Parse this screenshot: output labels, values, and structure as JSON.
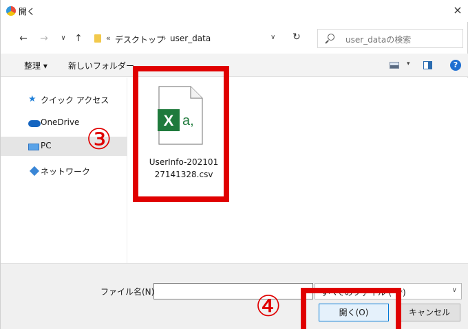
{
  "window": {
    "title": "開く",
    "close": "×"
  },
  "nav": {
    "back": "←",
    "forward": "→",
    "recent": "∨",
    "up": "↑",
    "breadcrumb_sep1": "«",
    "breadcrumb": [
      "デスクトップ",
      "user_data"
    ],
    "breadcrumb_sep2": "›",
    "address_dropdown": "∨",
    "refresh": "↻",
    "search_placeholder": "user_dataの検索"
  },
  "toolbar": {
    "organize": "整理 ▾",
    "new_folder": "新しいフォルダー",
    "view_dropdown": "▾",
    "help": "?"
  },
  "sidebar": {
    "items": [
      {
        "label": "クイック アクセス",
        "icon": "star-icon"
      },
      {
        "label": "OneDrive",
        "icon": "cloud-icon"
      },
      {
        "label": "PC",
        "icon": "pc-icon",
        "selected": true
      },
      {
        "label": "ネットワーク",
        "icon": "network-icon"
      }
    ]
  },
  "files": [
    {
      "name": "UserInfo-20210127141328.csv",
      "icon": "excel-csv-icon",
      "name_line1": "UserInfo-202101",
      "name_line2": "27141328.csv"
    }
  ],
  "bottom": {
    "filename_label": "ファイル名(N):",
    "filename_value": "",
    "filetype": "すべてのファイル (*.*)",
    "filetype_arrow": "∨",
    "open_label": "開く(O)",
    "cancel_label": "キャンセル"
  },
  "annotations": {
    "marker3": "③",
    "marker4": "④"
  },
  "colors": {
    "highlight": "#e00000",
    "excel_green": "#1f7a3c",
    "accent": "#0078d7"
  }
}
